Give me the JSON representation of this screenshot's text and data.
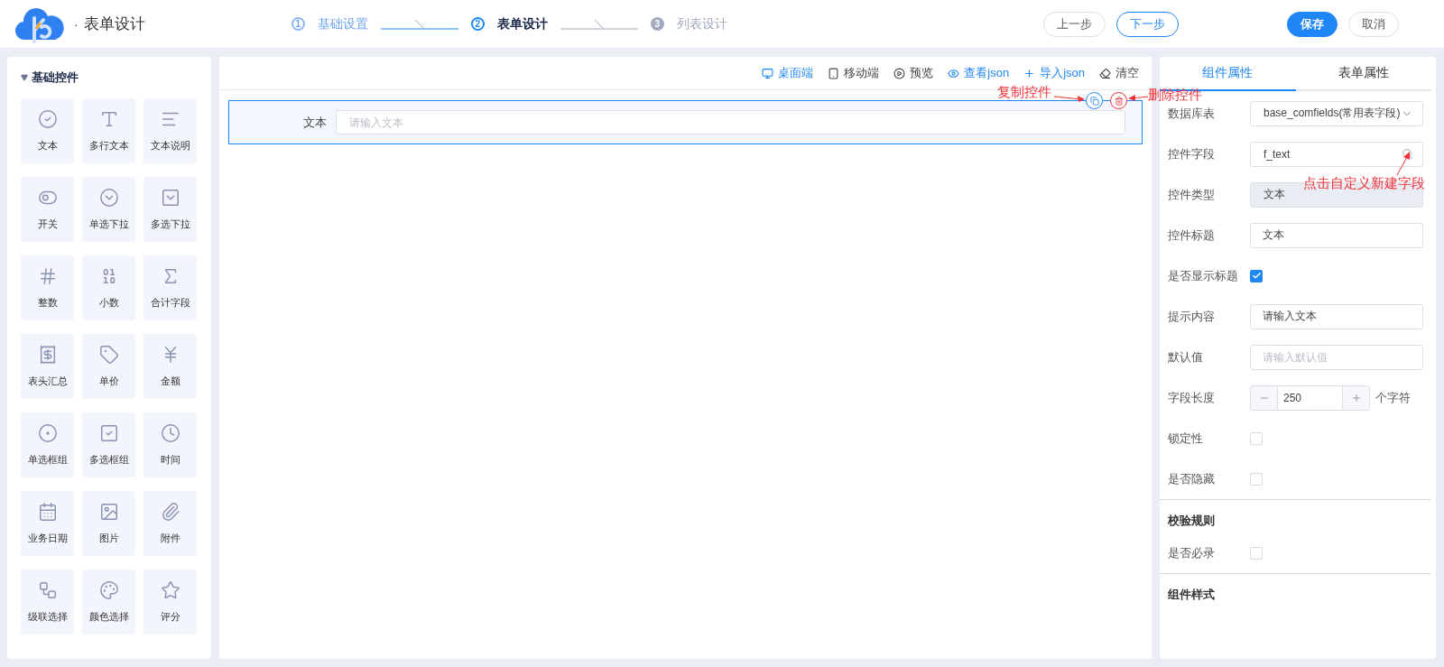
{
  "header": {
    "separator": "·",
    "title": "表单设计",
    "steps": [
      {
        "number": "1",
        "label": "基础设置",
        "completed": true,
        "selected": false
      },
      {
        "number": "2",
        "label": "表单设计",
        "completed": false,
        "selected": true
      },
      {
        "number": "3",
        "label": "列表设计",
        "completed": false,
        "selected": false
      }
    ],
    "nav_buttons": [
      {
        "label": "上一步",
        "kind": "default"
      },
      {
        "label": "下一步",
        "kind": "outline"
      }
    ],
    "actions": [
      {
        "label": "保存",
        "kind": "primary"
      },
      {
        "label": "取消",
        "kind": "default"
      }
    ]
  },
  "palette": {
    "title": "基础控件",
    "expanded": true,
    "items": [
      {
        "label": "文本"
      },
      {
        "label": "多行文本"
      },
      {
        "label": "文本说明"
      },
      {
        "label": "开关"
      },
      {
        "label": "单选下拉"
      },
      {
        "label": "多选下拉"
      },
      {
        "label": "整数"
      },
      {
        "label": "小数"
      },
      {
        "label": "合计字段"
      },
      {
        "label": "表头汇总"
      },
      {
        "label": "单价"
      },
      {
        "label": "金额"
      },
      {
        "label": "单选框组"
      },
      {
        "label": "多选框组"
      },
      {
        "label": "时间"
      },
      {
        "label": "业务日期"
      },
      {
        "label": "图片"
      },
      {
        "label": "附件"
      },
      {
        "label": "级联选择"
      },
      {
        "label": "颜色选择"
      },
      {
        "label": "评分"
      }
    ]
  },
  "canvas": {
    "toolbar": [
      {
        "label": "桌面端",
        "selected": true
      },
      {
        "label": "移动端",
        "selected": false
      },
      {
        "label": "预览",
        "kind": "default"
      },
      {
        "label": "查看json",
        "kind": "primary"
      },
      {
        "label": "导入json",
        "kind": "primary"
      },
      {
        "label": "清空",
        "kind": "default"
      }
    ],
    "fields": [
      {
        "label": "文本",
        "placeholder": "请输入文本",
        "selected": true
      }
    ],
    "annotations": [
      {
        "text": "复制控件"
      },
      {
        "text": "删除控件"
      }
    ]
  },
  "properties": {
    "tabs": [
      {
        "label": "组件属性",
        "selected": true
      },
      {
        "label": "表单属性",
        "selected": false
      }
    ],
    "rows": [
      {
        "kind": "select",
        "label": "数据库表",
        "value": "base_comfields(常用表字段)"
      },
      {
        "kind": "search",
        "label": "控件字段",
        "value": "f_text"
      },
      {
        "kind": "readonly",
        "label": "控件类型",
        "value": "文本"
      },
      {
        "kind": "input",
        "label": "控件标题",
        "value": "文本"
      },
      {
        "kind": "checkbox",
        "label": "是否显示标题",
        "checked": true
      },
      {
        "kind": "input",
        "label": "提示内容",
        "value": "请输入文本"
      },
      {
        "kind": "input",
        "label": "默认值",
        "placeholder": "请输入默认值"
      },
      {
        "kind": "number",
        "label": "字段长度",
        "value": "250",
        "suffix": "个字符"
      },
      {
        "kind": "checkbox",
        "label": "锁定性",
        "checked": false
      },
      {
        "kind": "checkbox",
        "label": "是否隐藏",
        "checked": false
      }
    ],
    "sections": [
      {
        "title": "校验规则",
        "rows": [
          {
            "kind": "checkbox",
            "label": "是否必录",
            "checked": false
          }
        ]
      },
      {
        "title": "组件样式"
      }
    ],
    "annotation": {
      "text": "点击自定义新建字段"
    }
  }
}
